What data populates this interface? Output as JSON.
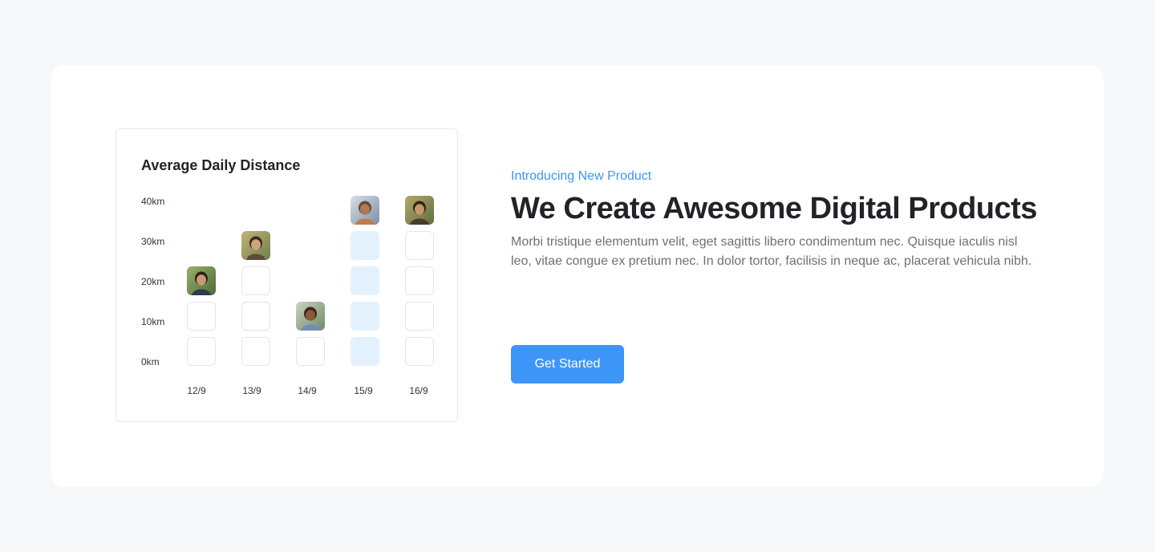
{
  "chart_data": {
    "type": "table",
    "title": "Average Daily Distance",
    "y_ticks": [
      "40km",
      "30km",
      "20km",
      "10km",
      "0km"
    ],
    "categories": [
      "12/9",
      "13/9",
      "14/9",
      "15/9",
      "16/9"
    ],
    "values_km": [
      20,
      30,
      10,
      40,
      40
    ],
    "highlighted_category": "15/9",
    "colors": {
      "cell_border": "#e3e5e8",
      "highlight_fill": "#e3f1ff"
    }
  },
  "hero": {
    "eyebrow": "Introducing New Product",
    "headline": "We Create Awesome Digital Products",
    "body": "Morbi tristique elementum velit, eget sagittis libero condimentum nec. Quisque iaculis nisl leo, vitae congue ex pretium nec. In dolor tortor, facilisis in neque ac, placerat vehicula nibh.",
    "cta_label": "Get Started"
  },
  "colors": {
    "accent": "#3e95f8",
    "eyebrow": "#3a97f3",
    "headline": "#202428",
    "body": "#6b7178",
    "page_bg": "#f7f8fa"
  },
  "icons": {
    "avatar": "person-photo-avatar"
  }
}
